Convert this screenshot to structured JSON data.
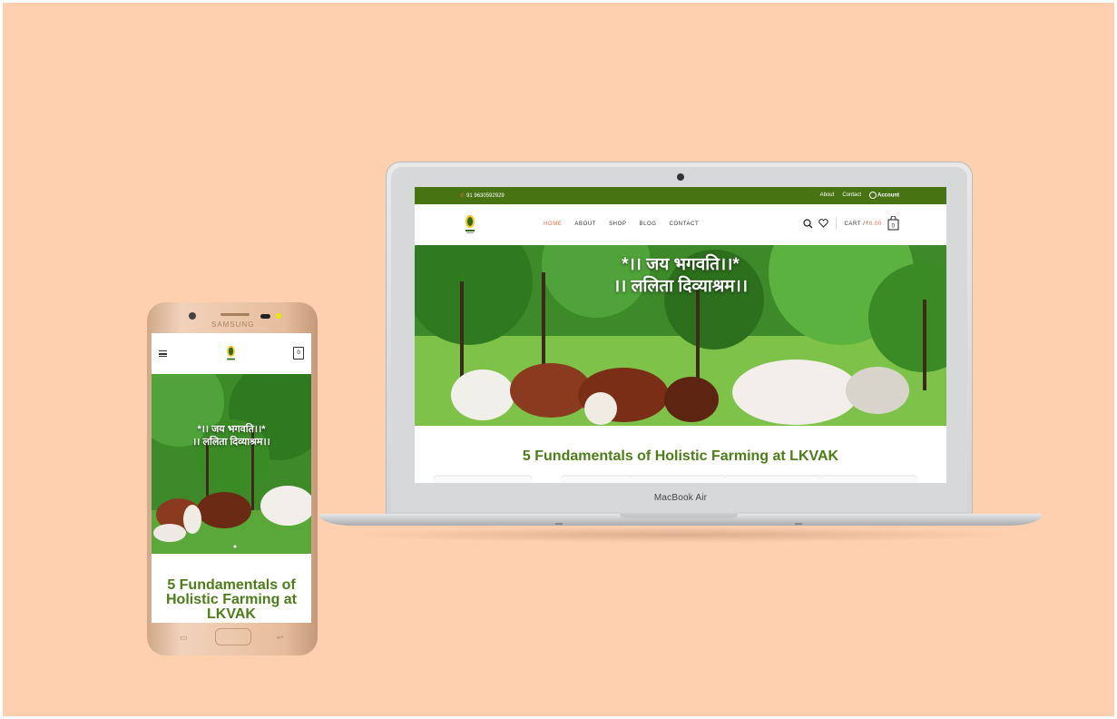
{
  "laptop": {
    "brand": "MacBook Air",
    "topbar": {
      "phone": "91 9630592929",
      "links": [
        "About",
        "Contact"
      ],
      "account": "Account"
    },
    "nav": {
      "menu": [
        "HOME",
        "ABOUT",
        "SHOP",
        "BLOG",
        "CONTACT"
      ],
      "cart_label": "CART /",
      "cart_price": "₹0.00",
      "cart_count": "0"
    },
    "hero": {
      "line1": "*।। जय भगवति।।*",
      "line2": "।। ललिता दिव्याश्रम।।"
    },
    "section_title": "5 Fundamentals of Holistic Farming at LKVAK"
  },
  "phone": {
    "brand": "SAMSUNG",
    "cart_count": "0",
    "hero": {
      "line1": "*।। जय भगवति।।*",
      "line2": "।। ललिता दिव्याश्रम।।"
    },
    "section_title": "5 Fundamentals of Holistic Farming at LKVAK"
  },
  "colors": {
    "background": "#fed0b0",
    "brand_green": "#477312",
    "title_green": "#4c7d1a",
    "accent_orange": "#e86a3a"
  }
}
